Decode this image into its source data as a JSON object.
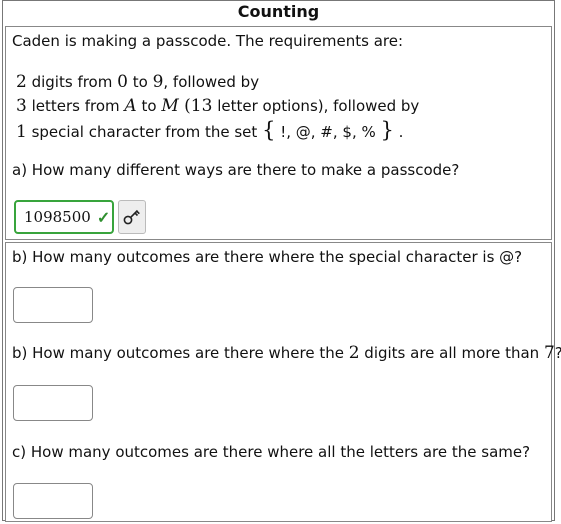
{
  "title": "Counting",
  "intro": "Caden is making a passcode. The requirements are:",
  "req1": {
    "num": "2",
    "text1": " digits from ",
    "a": "0",
    "to": " to ",
    "b": "9",
    "text2": ", followed by"
  },
  "req2": {
    "num": "3",
    "text1": " letters from ",
    "a": "A",
    "to": " to ",
    "b": "M",
    "paren_open": " (",
    "count": "13",
    "text2": " letter options), followed by"
  },
  "req3": {
    "num": "1",
    "text1": " special character from the set ",
    "open": "{",
    "set": " !, @, #, $, % ",
    "close": "}",
    "end": " ."
  },
  "qa": {
    "text": "a) How many different ways are there to make a passcode?",
    "answer": "1098500",
    "check": "✓"
  },
  "qb1": {
    "text": "b) How many outcomes are there where the special character is @?"
  },
  "qb2": {
    "text1": "b) How many outcomes are there where the ",
    "num": "2",
    "text2": " digits are all more than ",
    "num2": "7",
    "text3": "?"
  },
  "qc": {
    "text": "c) How many outcomes are there where all the letters are the same?"
  }
}
